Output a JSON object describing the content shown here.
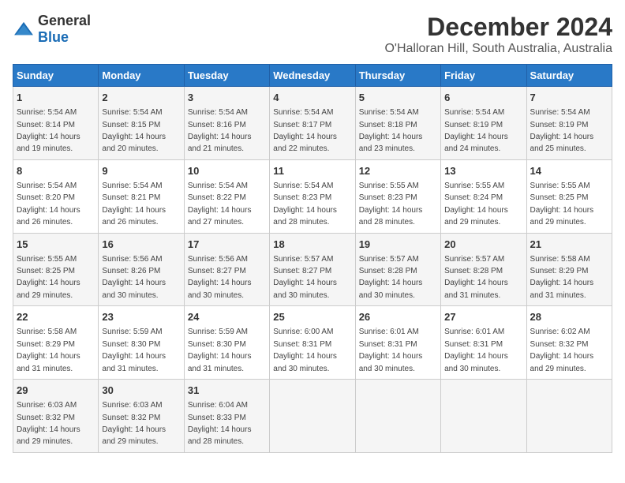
{
  "logo": {
    "general": "General",
    "blue": "Blue"
  },
  "title": "December 2024",
  "subtitle": "O'Halloran Hill, South Australia, Australia",
  "days_of_week": [
    "Sunday",
    "Monday",
    "Tuesday",
    "Wednesday",
    "Thursday",
    "Friday",
    "Saturday"
  ],
  "weeks": [
    [
      {
        "day": "1",
        "sunrise": "5:54 AM",
        "sunset": "8:14 PM",
        "daylight": "14 hours and 19 minutes."
      },
      {
        "day": "2",
        "sunrise": "5:54 AM",
        "sunset": "8:15 PM",
        "daylight": "14 hours and 20 minutes."
      },
      {
        "day": "3",
        "sunrise": "5:54 AM",
        "sunset": "8:16 PM",
        "daylight": "14 hours and 21 minutes."
      },
      {
        "day": "4",
        "sunrise": "5:54 AM",
        "sunset": "8:17 PM",
        "daylight": "14 hours and 22 minutes."
      },
      {
        "day": "5",
        "sunrise": "5:54 AM",
        "sunset": "8:18 PM",
        "daylight": "14 hours and 23 minutes."
      },
      {
        "day": "6",
        "sunrise": "5:54 AM",
        "sunset": "8:19 PM",
        "daylight": "14 hours and 24 minutes."
      },
      {
        "day": "7",
        "sunrise": "5:54 AM",
        "sunset": "8:19 PM",
        "daylight": "14 hours and 25 minutes."
      }
    ],
    [
      {
        "day": "8",
        "sunrise": "5:54 AM",
        "sunset": "8:20 PM",
        "daylight": "14 hours and 26 minutes."
      },
      {
        "day": "9",
        "sunrise": "5:54 AM",
        "sunset": "8:21 PM",
        "daylight": "14 hours and 26 minutes."
      },
      {
        "day": "10",
        "sunrise": "5:54 AM",
        "sunset": "8:22 PM",
        "daylight": "14 hours and 27 minutes."
      },
      {
        "day": "11",
        "sunrise": "5:54 AM",
        "sunset": "8:23 PM",
        "daylight": "14 hours and 28 minutes."
      },
      {
        "day": "12",
        "sunrise": "5:55 AM",
        "sunset": "8:23 PM",
        "daylight": "14 hours and 28 minutes."
      },
      {
        "day": "13",
        "sunrise": "5:55 AM",
        "sunset": "8:24 PM",
        "daylight": "14 hours and 29 minutes."
      },
      {
        "day": "14",
        "sunrise": "5:55 AM",
        "sunset": "8:25 PM",
        "daylight": "14 hours and 29 minutes."
      }
    ],
    [
      {
        "day": "15",
        "sunrise": "5:55 AM",
        "sunset": "8:25 PM",
        "daylight": "14 hours and 29 minutes."
      },
      {
        "day": "16",
        "sunrise": "5:56 AM",
        "sunset": "8:26 PM",
        "daylight": "14 hours and 30 minutes."
      },
      {
        "day": "17",
        "sunrise": "5:56 AM",
        "sunset": "8:27 PM",
        "daylight": "14 hours and 30 minutes."
      },
      {
        "day": "18",
        "sunrise": "5:57 AM",
        "sunset": "8:27 PM",
        "daylight": "14 hours and 30 minutes."
      },
      {
        "day": "19",
        "sunrise": "5:57 AM",
        "sunset": "8:28 PM",
        "daylight": "14 hours and 30 minutes."
      },
      {
        "day": "20",
        "sunrise": "5:57 AM",
        "sunset": "8:28 PM",
        "daylight": "14 hours and 31 minutes."
      },
      {
        "day": "21",
        "sunrise": "5:58 AM",
        "sunset": "8:29 PM",
        "daylight": "14 hours and 31 minutes."
      }
    ],
    [
      {
        "day": "22",
        "sunrise": "5:58 AM",
        "sunset": "8:29 PM",
        "daylight": "14 hours and 31 minutes."
      },
      {
        "day": "23",
        "sunrise": "5:59 AM",
        "sunset": "8:30 PM",
        "daylight": "14 hours and 31 minutes."
      },
      {
        "day": "24",
        "sunrise": "5:59 AM",
        "sunset": "8:30 PM",
        "daylight": "14 hours and 31 minutes."
      },
      {
        "day": "25",
        "sunrise": "6:00 AM",
        "sunset": "8:31 PM",
        "daylight": "14 hours and 30 minutes."
      },
      {
        "day": "26",
        "sunrise": "6:01 AM",
        "sunset": "8:31 PM",
        "daylight": "14 hours and 30 minutes."
      },
      {
        "day": "27",
        "sunrise": "6:01 AM",
        "sunset": "8:31 PM",
        "daylight": "14 hours and 30 minutes."
      },
      {
        "day": "28",
        "sunrise": "6:02 AM",
        "sunset": "8:32 PM",
        "daylight": "14 hours and 29 minutes."
      }
    ],
    [
      {
        "day": "29",
        "sunrise": "6:03 AM",
        "sunset": "8:32 PM",
        "daylight": "14 hours and 29 minutes."
      },
      {
        "day": "30",
        "sunrise": "6:03 AM",
        "sunset": "8:32 PM",
        "daylight": "14 hours and 29 minutes."
      },
      {
        "day": "31",
        "sunrise": "6:04 AM",
        "sunset": "8:33 PM",
        "daylight": "14 hours and 28 minutes."
      },
      null,
      null,
      null,
      null
    ]
  ]
}
